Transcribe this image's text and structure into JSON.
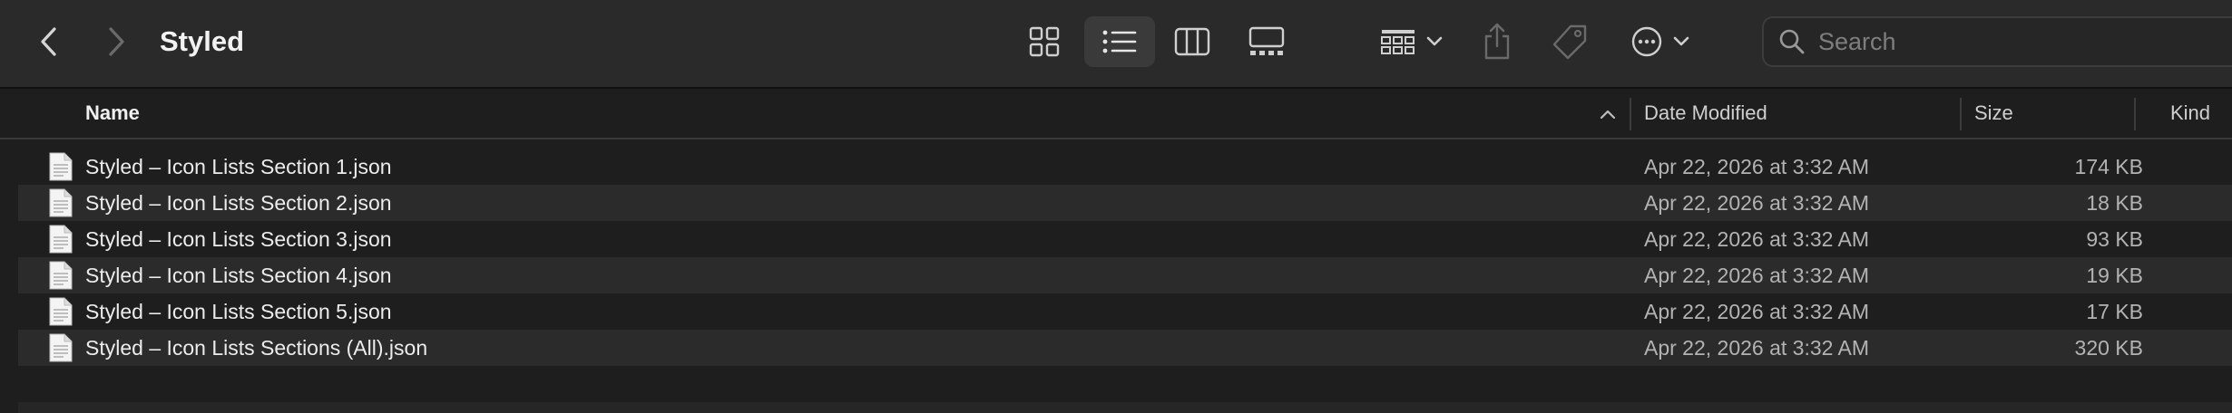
{
  "window": {
    "title": "Styled"
  },
  "toolbar": {
    "back_icon": "chevron-left-icon",
    "forward_icon": "chevron-right-icon",
    "view_modes": [
      "icons",
      "list",
      "columns",
      "gallery"
    ],
    "active_view": "list",
    "search": {
      "placeholder": "Search",
      "value": ""
    }
  },
  "columns": {
    "name": "Name",
    "date_modified": "Date Modified",
    "size": "Size",
    "kind": "Kind",
    "sort_direction": "ascending"
  },
  "files": [
    {
      "name": "Styled – Icon Lists Section 1.json",
      "date": "Apr 22, 2026 at 3:32 AM",
      "size": "174 KB"
    },
    {
      "name": "Styled – Icon Lists Section 2.json",
      "date": "Apr 22, 2026 at 3:32 AM",
      "size": "18 KB"
    },
    {
      "name": "Styled – Icon Lists Section 3.json",
      "date": "Apr 22, 2026 at 3:32 AM",
      "size": "93 KB"
    },
    {
      "name": "Styled – Icon Lists Section 4.json",
      "date": "Apr 22, 2026 at 3:32 AM",
      "size": "19 KB"
    },
    {
      "name": "Styled – Icon Lists Section 5.json",
      "date": "Apr 22, 2026 at 3:32 AM",
      "size": "17 KB"
    },
    {
      "name": "Styled – Icon Lists Sections (All).json",
      "date": "Apr 22, 2026 at 3:32 AM",
      "size": "320 KB"
    }
  ],
  "colors": {
    "background": "#1e1e1e",
    "toolbar": "#2a2a2a",
    "alt_row": "#2b2b2b",
    "text": "#ececec",
    "secondary_text": "#b3b3b3"
  }
}
